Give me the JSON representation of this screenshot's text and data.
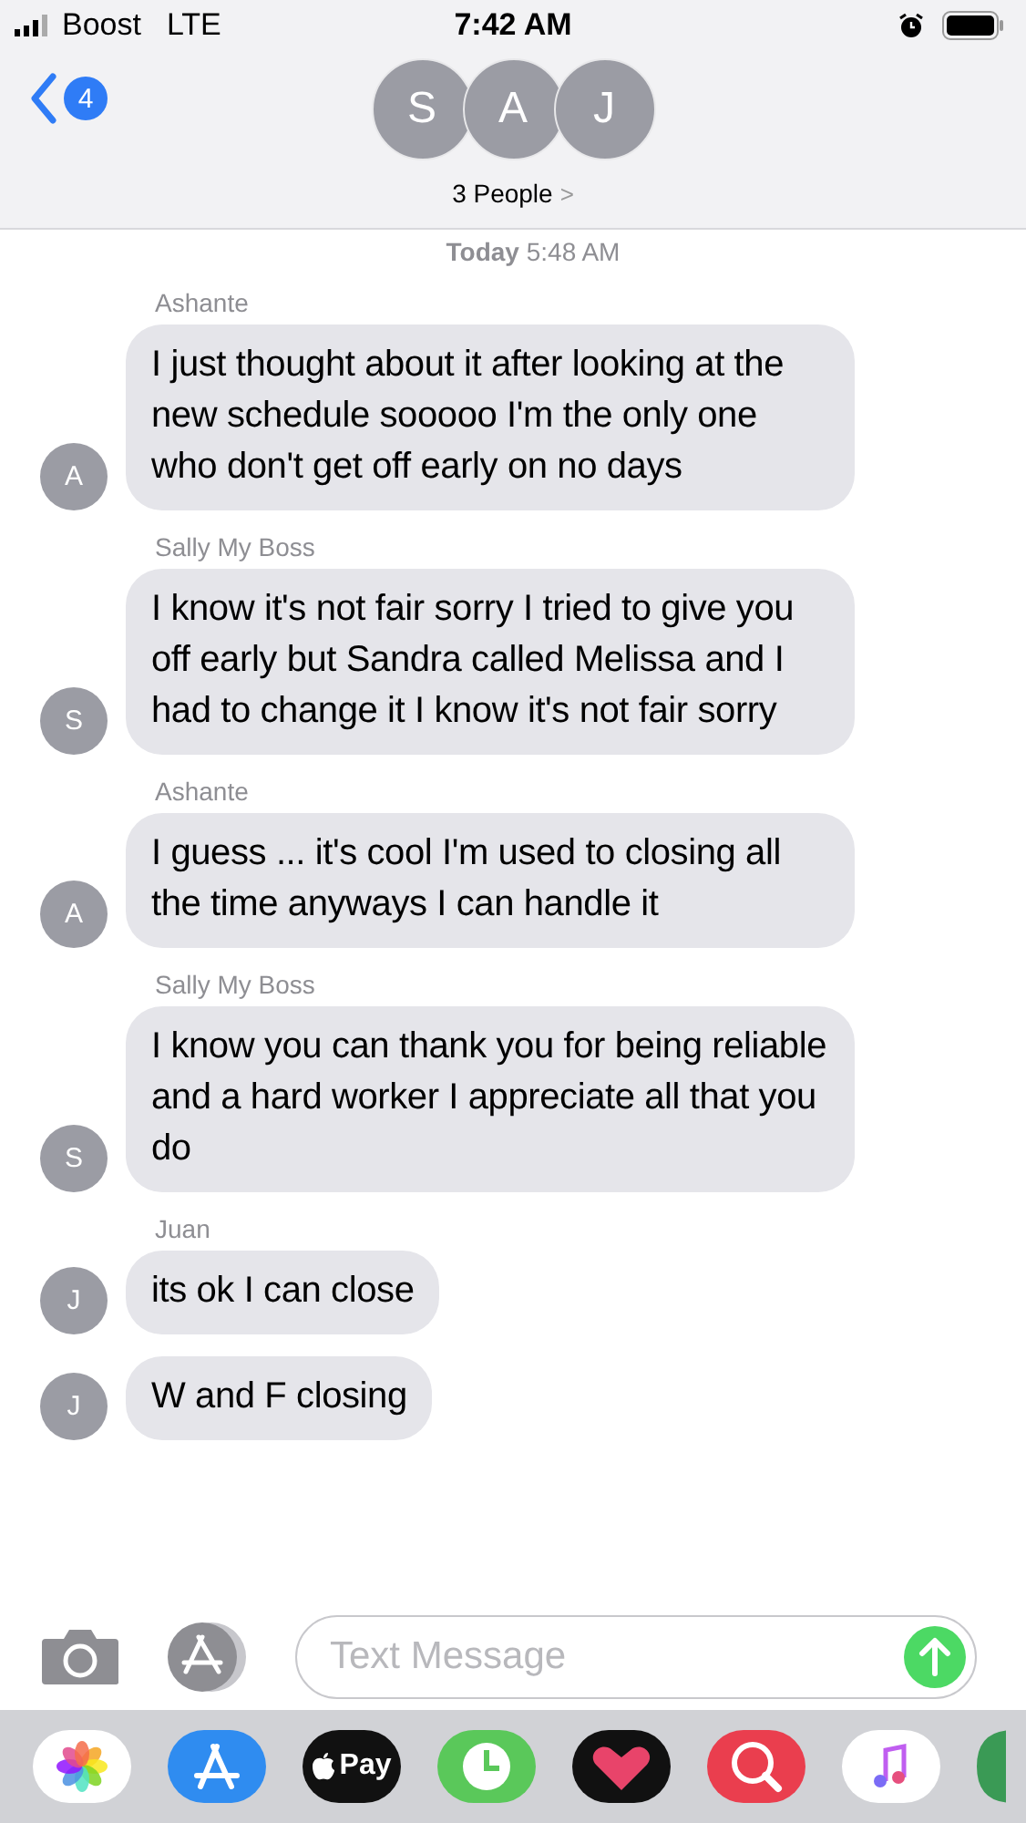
{
  "status_bar": {
    "carrier": "Boost",
    "network": "LTE",
    "time": "7:42 AM"
  },
  "header": {
    "back_badge": "4",
    "avatars": [
      "S",
      "A",
      "J"
    ],
    "title": "3 People",
    "chevron": ">"
  },
  "messages": [
    {
      "kind": "timestamp",
      "text": "**Today** 5:48 AM"
    },
    {
      "kind": "message",
      "sender": "Ashante",
      "avatar": "A",
      "text": "I just thought about it after looking at the new schedule sooooo I'm the only one who don't get off early on no days"
    },
    {
      "kind": "message",
      "sender": "Sally My Boss",
      "avatar": "S",
      "text": "I know it's not fair sorry I tried to give you off early but Sandra called Melissa and I had to change it I know it's not fair sorry"
    },
    {
      "kind": "message",
      "sender": "Ashante",
      "avatar": "A",
      "text": "I guess ... it's cool I'm used to closing all the time anyways I can handle it"
    },
    {
      "kind": "message",
      "sender": "Sally My Boss",
      "avatar": "S",
      "text": "I know you can thank you for being reliable and a hard worker I appreciate all that you do"
    },
    {
      "kind": "message",
      "sender": "Juan",
      "avatar": "J",
      "text": "its ok I can close"
    },
    {
      "kind": "message",
      "avatar": "J",
      "text": "W and F closing"
    }
  ],
  "compose": {
    "placeholder": "Text Message"
  },
  "dock": {
    "pay_label": "Pay"
  }
}
